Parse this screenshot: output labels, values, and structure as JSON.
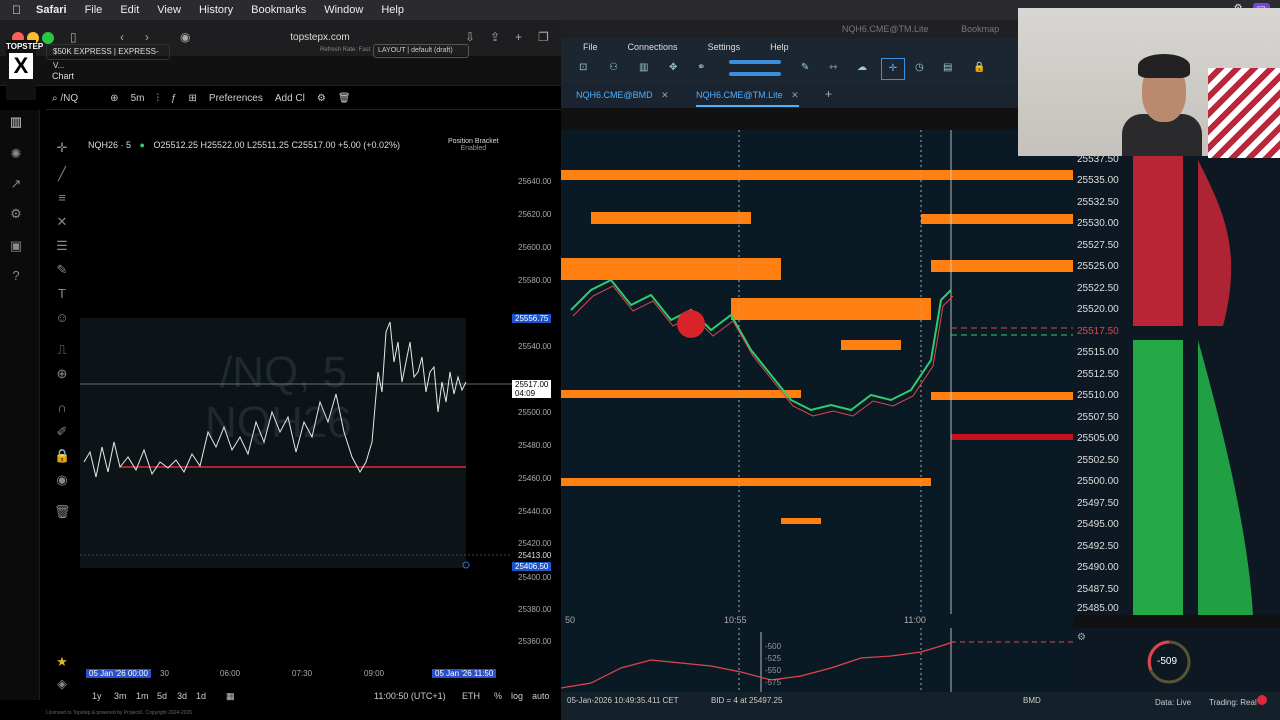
{
  "menubar": {
    "app": "Safari",
    "items": [
      "File",
      "Edit",
      "View",
      "History",
      "Bookmarks",
      "Window",
      "Help"
    ],
    "right": [
      "11:00"
    ]
  },
  "left": {
    "url": "topstepx.com",
    "logo_top": "TOPSTEP",
    "logo_x": "X",
    "account": "$50K EXPRESS | EXPRESS-V...",
    "refresh": "Refresh Rate: Fast",
    "layout": "LAYOUT | default (draft)",
    "chart_tab": "Chart",
    "symbol": "/NQ",
    "interval": "5m",
    "preferences": "Preferences",
    "add": "Add Cl",
    "title": "NQH26 · 5",
    "ohlc": "O25512.25 H25522.00 L25511.25 C25517.00 +5.00 (+0.02%)",
    "position_bracket": "Position Bracket",
    "enabled": "Enabled",
    "watermark1": "/NQ, 5",
    "watermark2": "NQH26",
    "price_labels": [
      "25640.00",
      "25620.00",
      "25600.00",
      "25580.00",
      "25556.75",
      "25540.00",
      "25517.00",
      "04:09",
      "25500.00",
      "25480.00",
      "25460.00",
      "25440.00",
      "25420.00",
      "25413.00",
      "25406.50",
      "25400.00",
      "25380.00",
      "25360.00"
    ],
    "x_labels": [
      "05 Jan '26  00:00",
      "30",
      "06:00",
      "07:30",
      "09:00",
      "05 Jan '26  11:50"
    ],
    "bottom": [
      "1y",
      "3m",
      "1m",
      "5d",
      "3d",
      "1d"
    ],
    "time": "11:00:50 (UTC+1)",
    "eth": "ETH",
    "percent": "%",
    "log": "log",
    "auto": "auto",
    "footer": "Licensed to Topstep & powered by ProjectX. Copyright 2024-2026"
  },
  "right": {
    "title": "NQH6.CME@TM.Lite",
    "app": "Bookmap",
    "menu": [
      "File",
      "Connections",
      "Settings",
      "Help"
    ],
    "tabs": [
      "NQH6.CME@BMD",
      "NQH6.CME@TM.Lite"
    ],
    "add_tab": "+",
    "prices": [
      "25537.50",
      "25535.00",
      "25532.50",
      "25530.00",
      "25527.50",
      "25525.00",
      "25522.50",
      "25520.00",
      "25517.50",
      "25515.00",
      "25512.50",
      "25510.00",
      "25507.50",
      "25505.00",
      "25502.50",
      "25500.00",
      "25497.50",
      "25495.00",
      "25492.50",
      "25490.00",
      "25487.50",
      "25485.00"
    ],
    "times": [
      "50",
      "10:55",
      "11:00"
    ],
    "cvd_labels": [
      "-500",
      "-525",
      "-550",
      "-575"
    ],
    "cvd_value": "-509",
    "status_left": "05-Jan-2026 10:49:35.411 CET",
    "status_mid": "BID = 4 at 25497.25",
    "status_bmd": "BMD",
    "data_live": "Data: Live",
    "trading": "Trading: Real"
  },
  "colors": {
    "accent": "#1e54c8",
    "heat": "#ff7f11",
    "bid": "#2ecc71",
    "ask": "#e0454e"
  }
}
